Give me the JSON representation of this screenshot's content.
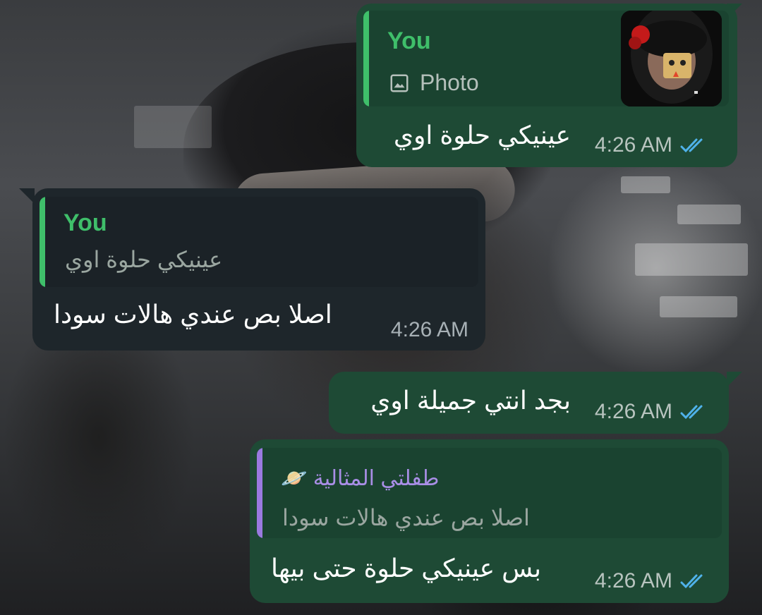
{
  "colors": {
    "outgoing_bubble": "#1e4a35",
    "incoming_bubble": "#1e262b",
    "you_name": "#3fbf6a",
    "reply_name_other": "#a98ee6",
    "reply_bar_other": "#9a7ae0",
    "read_ticks": "#4fb2ea"
  },
  "messages": [
    {
      "direction": "outgoing",
      "reply": {
        "sender": "You",
        "icon": "image-icon",
        "label": "Photo",
        "has_thumbnail": true
      },
      "text": "عينيكي حلوة اوي",
      "time": "4:26 AM",
      "status": "read"
    },
    {
      "direction": "incoming",
      "reply": {
        "sender": "You",
        "quoted": "عينيكي حلوة اوي"
      },
      "text": "اصلا بص عندي هالات سودا",
      "time": "4:26 AM"
    },
    {
      "direction": "outgoing",
      "text": "بجد انتي جميلة اوي",
      "time": "4:26 AM",
      "status": "read"
    },
    {
      "direction": "outgoing",
      "reply": {
        "sender": "طفلتي المثالية 🪐",
        "quoted": "اصلا بص عندي هالات سودا"
      },
      "text": "بس عينيكي حلوة حتى بيها",
      "time": "4:26 AM",
      "status": "read"
    }
  ]
}
